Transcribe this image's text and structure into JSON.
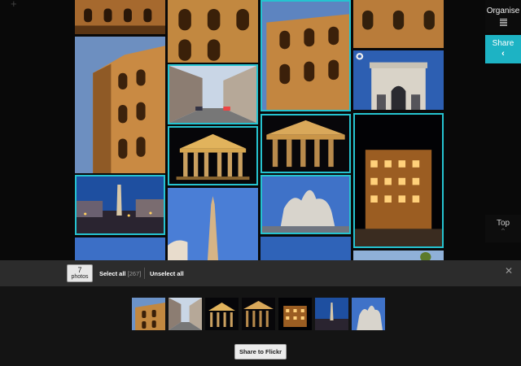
{
  "sidebar": {
    "organise_label": "Organise",
    "share_label": "Share",
    "share_icon": "chevron-left-icon",
    "top_label": "Top",
    "top_icon": "chevron-up-icon"
  },
  "gallery": {
    "add_icon": "plus-icon",
    "selection_color": "#25c3d0",
    "photos": [
      {
        "subject": "colosseum",
        "selected": false
      },
      {
        "subject": "colosseum",
        "selected": false
      },
      {
        "subject": "colosseum",
        "selected": true
      },
      {
        "subject": "colosseum",
        "selected": false
      },
      {
        "subject": "colosseum",
        "selected": false
      },
      {
        "subject": "street",
        "selected": true
      },
      {
        "subject": "arch",
        "selected": false
      },
      {
        "subject": "pantheon",
        "selected": true
      },
      {
        "subject": "pantheon",
        "selected": true
      },
      {
        "subject": "piazza-navona",
        "selected": true
      },
      {
        "subject": "hotel-night",
        "selected": true
      },
      {
        "subject": "fountain",
        "selected": true
      },
      {
        "subject": "obelisk",
        "selected": false
      },
      {
        "subject": "sky",
        "selected": false
      },
      {
        "subject": "sky",
        "selected": false
      },
      {
        "subject": "street-tree",
        "selected": false
      }
    ]
  },
  "selection_bar": {
    "count": "7",
    "count_unit": "photos",
    "select_all_label": "Select all",
    "select_all_count": "[267]",
    "unselect_all_label": "Unselect all",
    "close_icon": "close-icon"
  },
  "tray": {
    "thumbnails": [
      "colosseum",
      "street",
      "pantheon",
      "pantheon",
      "hotel-night",
      "piazza-navona",
      "fountain"
    ],
    "share_button_label": "Share to Flickr"
  }
}
